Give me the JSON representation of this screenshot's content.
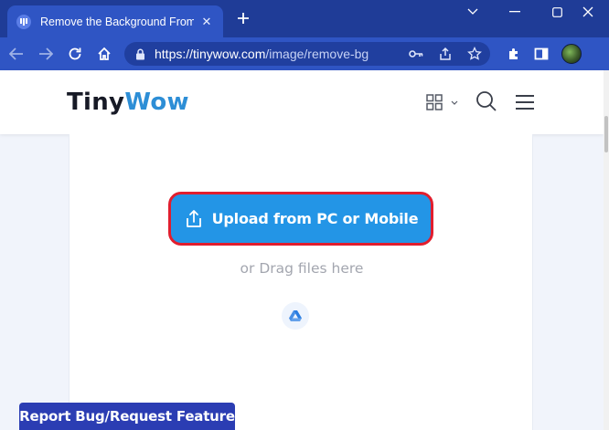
{
  "browser": {
    "tab": {
      "title": "Remove the Background From an",
      "close_glyph": "✕",
      "favicon": "tinywow-favicon-icon"
    },
    "new_tab_glyph": "+",
    "window_controls": {
      "dropdown": "chevron-down-icon",
      "minimize": "minimize-icon",
      "maximize": "maximize-icon",
      "close": "close-icon"
    },
    "toolbar": {
      "back": "back-arrow-icon",
      "forward": "forward-arrow-icon",
      "reload": "reload-icon",
      "home": "home-icon",
      "url_host": "https://tinywow.com",
      "url_path": "/image/remove-bg",
      "omnibox_icons": [
        "lock-icon",
        "key-icon",
        "share-icon",
        "star-icon"
      ],
      "right_icons": [
        "extensions-icon",
        "side-panel-icon",
        "profile-avatar"
      ]
    },
    "colors": {
      "titlebar": "#1f3c97",
      "toolbar": "#2f55c4",
      "omnibox": "#203f9f"
    }
  },
  "site": {
    "logo_part1": "Tiny",
    "logo_part2": "Wow",
    "header_icons": [
      "grid-icon",
      "chevron-down-icon",
      "search-icon",
      "hamburger-menu-icon"
    ],
    "upload_button_label": "Upload from PC or Mobile",
    "drag_hint": "or Drag files here",
    "google_drive_icon": "google-drive-icon",
    "report_button_label": "Report Bug/Request Feature",
    "colors": {
      "brand_blue": "#2d8ed6",
      "upload_button": "#2395e6",
      "highlight_border": "#e11e2e",
      "report_button": "#2b3db3"
    }
  }
}
